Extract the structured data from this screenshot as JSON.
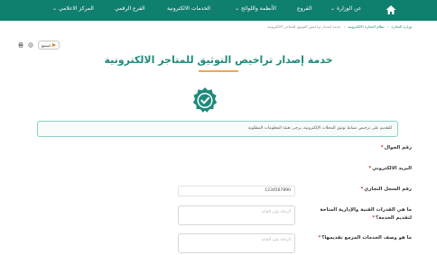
{
  "navbar": {
    "home_icon": "home-icon",
    "bg_color": "#0f7f6e",
    "items": [
      {
        "label": "عن الوزارة",
        "dropdown": true
      },
      {
        "label": "الفروع",
        "dropdown": false
      },
      {
        "label": "الأنظمة واللوائح",
        "dropdown": true
      },
      {
        "label": "الخدمات الالكترونية",
        "dropdown": false
      },
      {
        "label": "الفرع الرقمي",
        "dropdown": false
      },
      {
        "label": "المركز الاعلامي",
        "dropdown": true
      }
    ]
  },
  "breadcrumb": {
    "items": [
      "وزارة التجارة",
      "نظام التجارة الالكترونية",
      "خدمة إصدار تراخيص التوثيق للمتاجر الالكترونية"
    ]
  },
  "toolbar": {
    "listen_label": "استمع",
    "print_icon": "print-icon",
    "settings_icon": "gear-icon"
  },
  "page": {
    "title": "خدمة إصدار تراخيص التوثيق للمتاجر الالكترونية",
    "accent_color": "#1f8a7a",
    "underline_color": "#f3a64a"
  },
  "info": {
    "text": "للتقديم على ترخيص نشاط توثيق المحلات الإلكترونية، يرجى تعبئة المعلومات المطلوبة"
  },
  "form": {
    "mobile": {
      "label": "رقم الجوال",
      "required_mark": "*",
      "value": ""
    },
    "email": {
      "label": "البريد الالكتروني",
      "required_mark": "*",
      "value": ""
    },
    "commercial_register": {
      "label": "رقم السجل التجاري",
      "required_mark": "*",
      "value": "1234567890"
    },
    "capabilities": {
      "label_line1": "ما هي القدرات الفنية والإدارية المتاحة",
      "label_line2": "لتقديم الخدمة؟",
      "required_mark": "*",
      "placeholder": "الرجاء ملئ الخانة"
    },
    "services": {
      "label": "ما هو وصف الخدمات المزمع تقديمها؟",
      "required_mark": "*",
      "placeholder": "الرجاء ملئ الخانة"
    }
  }
}
